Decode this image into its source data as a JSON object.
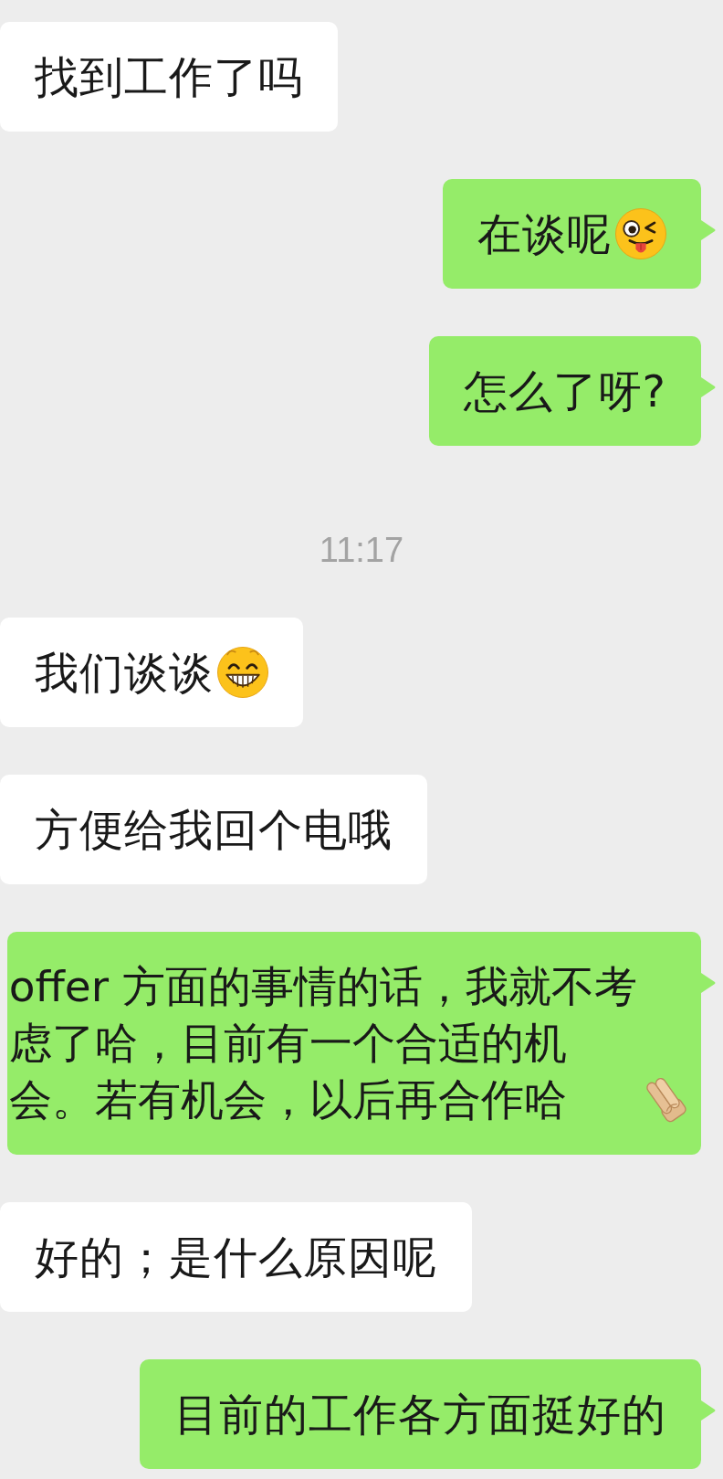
{
  "messages": [
    {
      "kind": "received",
      "lines": [
        "找到工作了吗"
      ]
    },
    {
      "kind": "sent",
      "lines": [
        "在谈呢"
      ],
      "emoji": {
        "kind": "winking-face"
      }
    },
    {
      "kind": "sent",
      "lines": [
        "怎么了呀?"
      ]
    },
    {
      "kind": "time",
      "text": "11:17"
    },
    {
      "kind": "received",
      "lines": [
        "我们谈谈"
      ],
      "emoji": {
        "kind": "grinning-face"
      }
    },
    {
      "kind": "received",
      "lines": [
        "方便给我回个电哦"
      ]
    },
    {
      "kind": "sent",
      "lines": [
        "offer 方面的事情的话，我就不考",
        "虑了哈，目前有一个合适的机",
        "会。若有机会，以后再合作哈"
      ],
      "emoji": {
        "kind": "folded-hands"
      }
    },
    {
      "kind": "received",
      "lines": [
        "好的；是什么原因呢"
      ]
    },
    {
      "kind": "sent",
      "lines": [
        "目前的工作各方面挺好的"
      ]
    }
  ]
}
